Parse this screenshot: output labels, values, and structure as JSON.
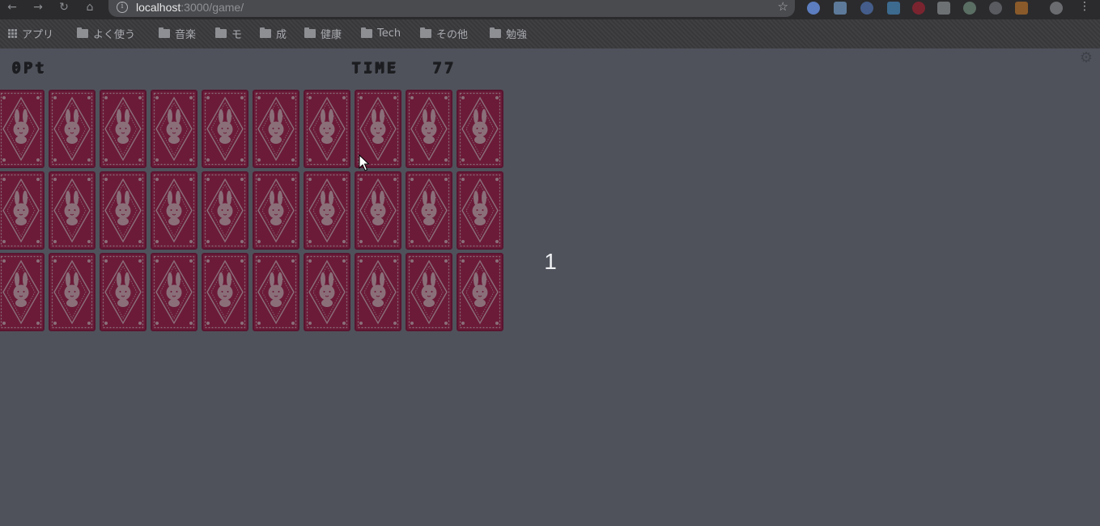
{
  "browser": {
    "url_host": "localhost",
    "url_path": ":3000/game/",
    "bookmarks": [
      "アプリ",
      "よく使う",
      "音楽",
      "モ",
      "成",
      "健康",
      "Tech",
      "その他",
      "勉強"
    ]
  },
  "game": {
    "score_label": "0Pt",
    "time_label": "TIME",
    "time_value": "77",
    "countdown": "1",
    "card_rows": 3,
    "card_cols": 10,
    "card_back": "rabbit-card-back"
  },
  "colors": {
    "background": "#4f525b",
    "card": "#6b1b38",
    "card_pattern": "#8a6f79",
    "text": "#1c1d20"
  }
}
